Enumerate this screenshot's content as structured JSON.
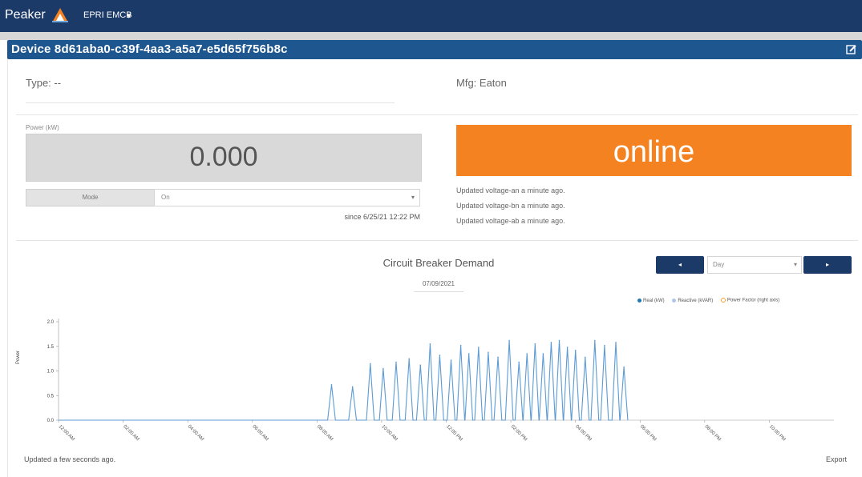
{
  "app": {
    "brand": "Peaker",
    "menu_label": "EPRI EMCB",
    "menu_caret": "▾"
  },
  "device": {
    "title": "Device 8d61aba0-c39f-4aa3-a5a7-e5d65f756b8c"
  },
  "info": {
    "type": "Type: --",
    "mfg": "Mfg: Eaton"
  },
  "power": {
    "label": "Power (kW)",
    "value": "0.000"
  },
  "mode": {
    "label": "Mode",
    "value": "On",
    "since": "since 6/25/21 12:22 PM"
  },
  "status": {
    "text": "online",
    "color": "#f58220"
  },
  "updates": [
    "Updated voltage-an a minute ago.",
    "Updated voltage-bn a minute ago.",
    "Updated voltage-ab a minute ago."
  ],
  "chart_controls": {
    "prev_label": "◂",
    "next_label": "▸",
    "range": "Day",
    "date": "07/09/2021",
    "title": "Circuit Breaker Demand"
  },
  "legend": [
    {
      "name": "Real (kW)",
      "color": "#1f77b4"
    },
    {
      "name": "Reactive (kVAR)",
      "color": "#aec7e8"
    },
    {
      "name": "Power Factor (right axis)",
      "color": "#ff9e2c"
    }
  ],
  "footer": {
    "updated": "Updated a few seconds ago.",
    "export": "Export"
  },
  "chart_data": {
    "type": "line",
    "ylabel": "Power",
    "ylim": [
      0,
      2.0
    ],
    "yticks": [
      "2.0",
      "1.5",
      "1.0",
      "0.5",
      "0.0"
    ],
    "xlim": [
      0,
      24
    ],
    "xticks": [
      "12:00 AM",
      "02:00 AM",
      "04:00 AM",
      "06:00 AM",
      "08:00 AM",
      "10:00 AM",
      "12:00 PM",
      "02:00 PM",
      "04:00 PM",
      "06:00 PM",
      "08:00 PM",
      "10:00 PM"
    ],
    "series": [
      {
        "name": "Real (kW)",
        "peaks": [
          [
            8.45,
            0.72
          ],
          [
            9.1,
            0.68
          ],
          [
            9.65,
            1.15
          ],
          [
            10.05,
            1.05
          ],
          [
            10.45,
            1.18
          ],
          [
            10.85,
            1.25
          ],
          [
            11.2,
            1.12
          ],
          [
            11.5,
            1.55
          ],
          [
            11.8,
            1.32
          ],
          [
            12.15,
            1.22
          ],
          [
            12.45,
            1.52
          ],
          [
            12.7,
            1.35
          ],
          [
            13.0,
            1.48
          ],
          [
            13.3,
            1.38
          ],
          [
            13.6,
            1.28
          ],
          [
            13.95,
            1.62
          ],
          [
            14.25,
            1.18
          ],
          [
            14.5,
            1.35
          ],
          [
            14.75,
            1.55
          ],
          [
            15.0,
            1.35
          ],
          [
            15.25,
            1.58
          ],
          [
            15.5,
            1.62
          ],
          [
            15.75,
            1.48
          ],
          [
            16.0,
            1.42
          ],
          [
            16.3,
            1.28
          ],
          [
            16.6,
            1.62
          ],
          [
            16.9,
            1.52
          ],
          [
            17.25,
            1.58
          ],
          [
            17.5,
            1.08
          ]
        ]
      }
    ]
  }
}
